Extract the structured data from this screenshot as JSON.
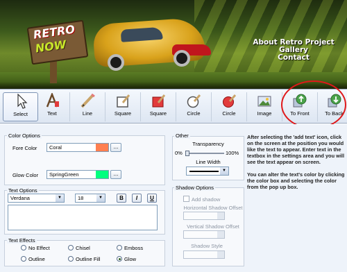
{
  "banner": {
    "logo_line1": "RETRO",
    "logo_line2": "NOW",
    "nav": [
      "About Retro Project",
      "Gallery",
      "Contact"
    ]
  },
  "toolbar": {
    "tools": [
      {
        "label": "Select",
        "icon": "cursor-arrow-icon",
        "active": true
      },
      {
        "label": "Text",
        "icon": "text-tool-icon"
      },
      {
        "label": "Line",
        "icon": "pencil-line-icon"
      },
      {
        "label": "Square",
        "icon": "square-outline-icon"
      },
      {
        "label": "Square",
        "icon": "square-filled-icon"
      },
      {
        "label": "Circle",
        "icon": "circle-outline-icon"
      },
      {
        "label": "Circle",
        "icon": "circle-filled-icon"
      },
      {
        "label": "Image",
        "icon": "image-icon"
      },
      {
        "label": "To Front",
        "icon": "bring-to-front-icon"
      },
      {
        "label": "To Back",
        "icon": "send-to-back-icon"
      }
    ]
  },
  "color_options": {
    "title": "Color Options",
    "fore_label": "Fore Color",
    "fore_value": "Coral",
    "fore_swatch": "#FF7F50",
    "glow_label": "Glow Color",
    "glow_value": "SpringGreen",
    "glow_swatch": "#00FF7F",
    "browse": "..."
  },
  "text_options": {
    "title": "Text Options",
    "font": "Verdana",
    "size": "18",
    "bold": "B",
    "italic": "I",
    "underline": "U",
    "text_value": ""
  },
  "text_effects": {
    "title": "Text Effects",
    "options": [
      {
        "label": "No Effect",
        "selected": false
      },
      {
        "label": "Chisel",
        "selected": false
      },
      {
        "label": "Emboss",
        "selected": false
      },
      {
        "label": "Outline",
        "selected": false
      },
      {
        "label": "Outline Fill",
        "selected": false
      },
      {
        "label": "Glow",
        "selected": true
      }
    ]
  },
  "other": {
    "title": "Other",
    "transparency_label": "Transparency",
    "min": "0%",
    "max": "100%",
    "transparency_value": 0.0,
    "line_width_label": "Line Width"
  },
  "shadow_options": {
    "title": "Shadow Options",
    "add_shadow": "Add shadow",
    "h_offset": "Horizontal Shadow Offset",
    "v_offset": "Vertical Shadow Offset",
    "style": "Shadow Style"
  },
  "help": {
    "p1": "After selecting the 'add text' icon, click on the screen at the position you would like the text to appear. Enter text in the textbox in the settings area and you will see the text appear on screen.",
    "p2": "You can alter the text's color by clicking the color box and selecting the color from the pop up box."
  },
  "colors": {
    "annotation": "#E0181A",
    "accent": "#7D93B4"
  }
}
